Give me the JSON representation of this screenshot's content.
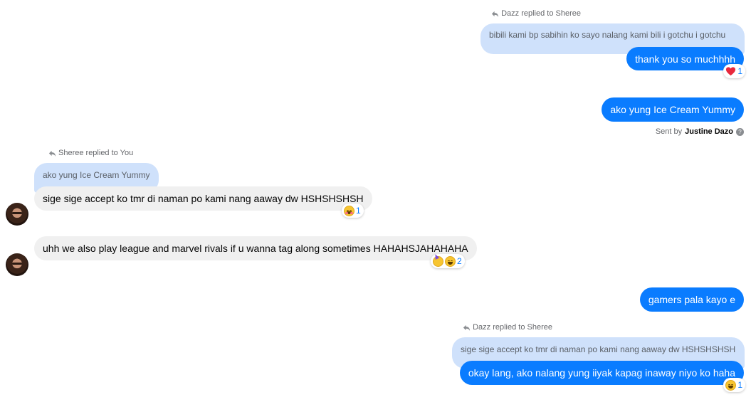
{
  "colors": {
    "outgoing": "#0a7cff",
    "incoming": "#f0f0f0",
    "quoted": "#cfe1fb",
    "reaction_count": "#0a7cff"
  },
  "messages": {
    "m1": {
      "reply_label": "Dazz replied to Sheree",
      "quoted": "bibili kami bp sabihin ko sayo nalang kami bili i gotchu i gotchu",
      "text": "thank you so muchhhh",
      "reaction_icon": "heart-icon",
      "reaction_count": "1"
    },
    "m2": {
      "text": "ako yung Ice Cream Yummy",
      "sent_by_prefix": "Sent by",
      "sent_by_name": "Justine Dazo",
      "info_icon": "info-icon"
    },
    "m3": {
      "reply_label": "Sheree replied to You",
      "quoted": "ako yung Ice Cream Yummy",
      "text": "sige sige accept ko tmr di naman po kami nang aaway dw HSHSHSHSH",
      "reaction_icon": "smiling-face-with-hearts-icon",
      "reaction_count": "1"
    },
    "m4": {
      "text": "uhh we also play league and marvel rivals if u wanna tag along sometimes HAHAHSJAHAHAHA",
      "reaction_icons": [
        "partying-face-icon",
        "grinning-squinting-face-icon"
      ],
      "reaction_count": "2"
    },
    "m5": {
      "text": "gamers pala kayo e"
    },
    "m6": {
      "reply_label": "Dazz replied to Sheree",
      "quoted": "sige sige accept ko tmr di naman po kami nang aaway dw HSHSHSHSH",
      "text": "okay lang, ako nalang yung iiyak kapag inaway niyo ko haha",
      "reaction_icon": "grinning-squinting-face-icon",
      "reaction_count": "1"
    }
  }
}
